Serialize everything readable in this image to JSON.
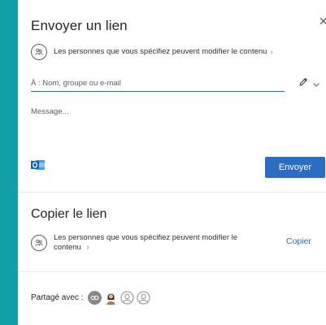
{
  "send_link": {
    "title": "Envoyer un lien",
    "close_glyph": "✕",
    "permission_text": "Les personnes que vous spécifiez peuvent modifier le contenu",
    "chevron": "›",
    "to_placeholder": "À : Nom, groupe ou e-mail",
    "to_value": "",
    "message_placeholder": "Message...",
    "send_label": "Envoyer",
    "outlook_icon": "outlook-icon",
    "pencil_icon": "pencil-icon"
  },
  "copy_link": {
    "title": "Copier le lien",
    "permission_text_line1": "Les personnes que vous spécifiez peuvent modifier le",
    "permission_text_line2": "contenu",
    "chevron": "›",
    "copy_label": "Copier"
  },
  "shared_with": {
    "label": "Partagé avec :",
    "avatars": [
      "link-avatar",
      "person-avatar",
      "outline-avatar",
      "outline-avatar"
    ]
  },
  "colors": {
    "accent": "#2b6cc4",
    "background": "#11a0a8",
    "outlook": "#0a64c2"
  }
}
